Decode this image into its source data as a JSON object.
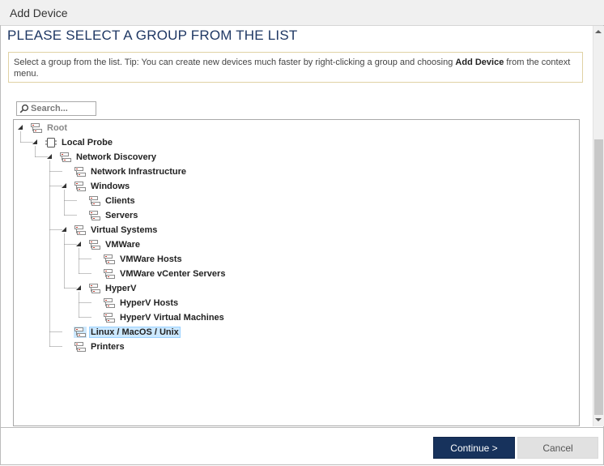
{
  "window": {
    "title": "Add Device"
  },
  "heading": "PLEASE SELECT A GROUP FROM THE LIST",
  "info": {
    "text_before": "Select a group from the list. Tip: You can create new devices much faster by right-clicking a group and choosing ",
    "bold": "Add Device",
    "text_after": " from the context menu."
  },
  "search": {
    "placeholder": "Search..."
  },
  "tree": {
    "nodes": [
      {
        "label": "Root",
        "icon": "group-icon",
        "state": "expanded",
        "disabled": true
      },
      {
        "label": "Local Probe",
        "icon": "probe-icon",
        "state": "expanded"
      },
      {
        "label": "Network Discovery",
        "icon": "group-icon",
        "state": "expanded"
      },
      {
        "label": "Network Infrastructure",
        "icon": "group-icon",
        "state": "leaf"
      },
      {
        "label": "Windows",
        "icon": "group-icon",
        "state": "expanded"
      },
      {
        "label": "Clients",
        "icon": "group-icon",
        "state": "leaf"
      },
      {
        "label": "Servers",
        "icon": "group-icon",
        "state": "leaf"
      },
      {
        "label": "Virtual Systems",
        "icon": "group-icon",
        "state": "expanded"
      },
      {
        "label": "VMWare",
        "icon": "group-icon",
        "state": "expanded"
      },
      {
        "label": "VMWare Hosts",
        "icon": "group-icon",
        "state": "leaf"
      },
      {
        "label": "VMWare vCenter Servers",
        "icon": "group-icon",
        "state": "leaf"
      },
      {
        "label": "HyperV",
        "icon": "group-icon",
        "state": "expanded"
      },
      {
        "label": "HyperV Hosts",
        "icon": "group-icon",
        "state": "leaf"
      },
      {
        "label": "HyperV Virtual Machines",
        "icon": "group-icon",
        "state": "leaf"
      },
      {
        "label": "Linux / MacOS / Unix",
        "icon": "group-icon",
        "state": "leaf",
        "selected": true
      },
      {
        "label": "Printers",
        "icon": "group-icon",
        "state": "leaf"
      }
    ]
  },
  "buttons": {
    "continue": "Continue >",
    "cancel": "Cancel"
  },
  "colors": {
    "accent": "#17325c",
    "heading": "#1f3864",
    "selection": "#cce8ff"
  }
}
